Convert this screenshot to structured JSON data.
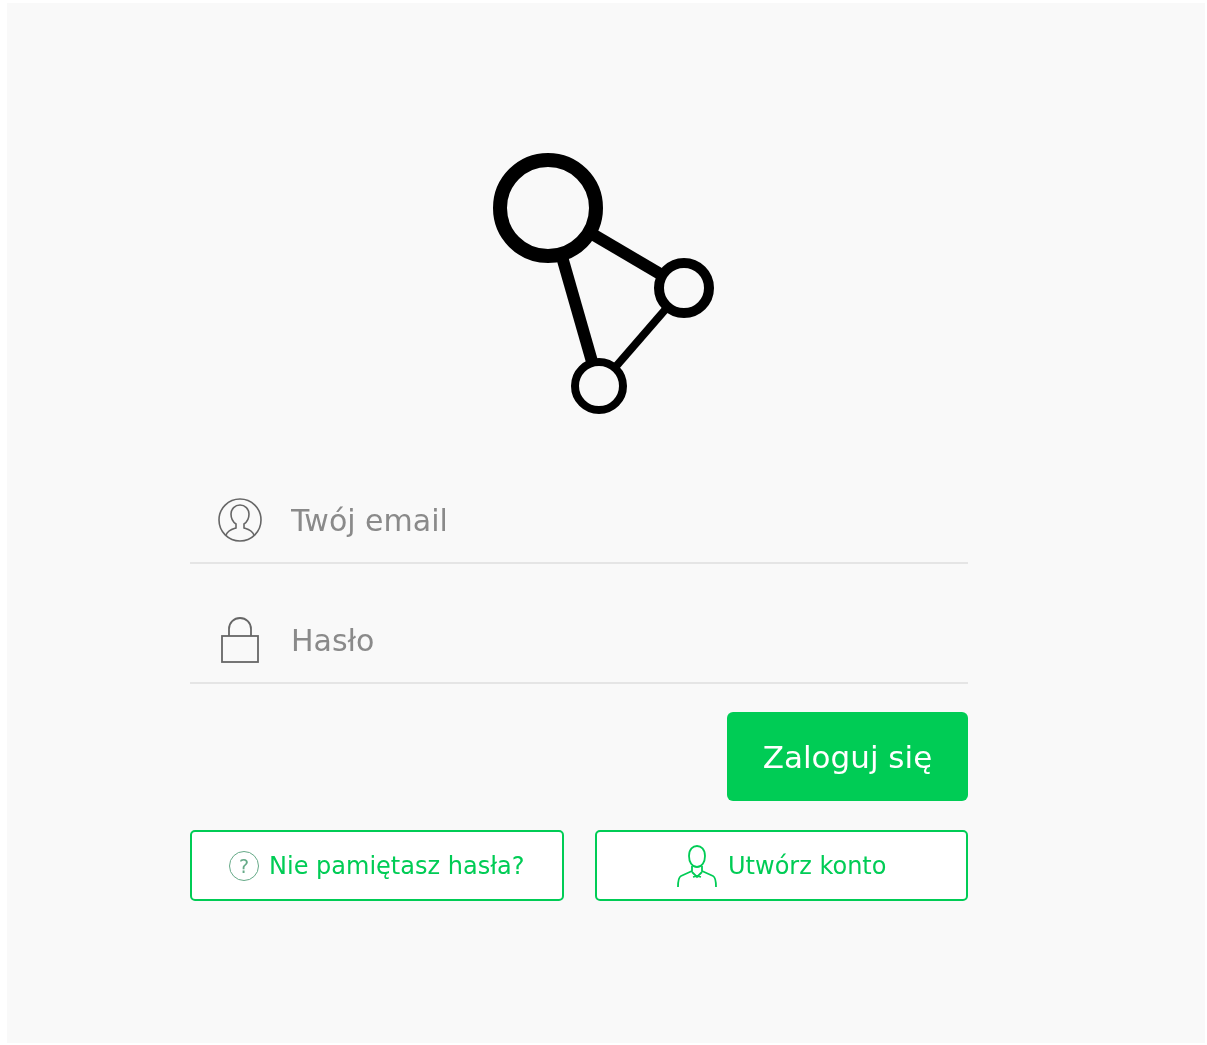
{
  "fields": [
    {
      "kind": "email",
      "placeholder": "Twój email"
    },
    {
      "kind": "password",
      "placeholder": "Hasło"
    }
  ],
  "login_button": {
    "label": "Zaloguj się"
  },
  "links": [
    {
      "kind": "help",
      "icon": "?",
      "label": "Nie pamiętasz hasła?"
    },
    {
      "kind": "account",
      "label": "Utwórz konto"
    }
  ]
}
